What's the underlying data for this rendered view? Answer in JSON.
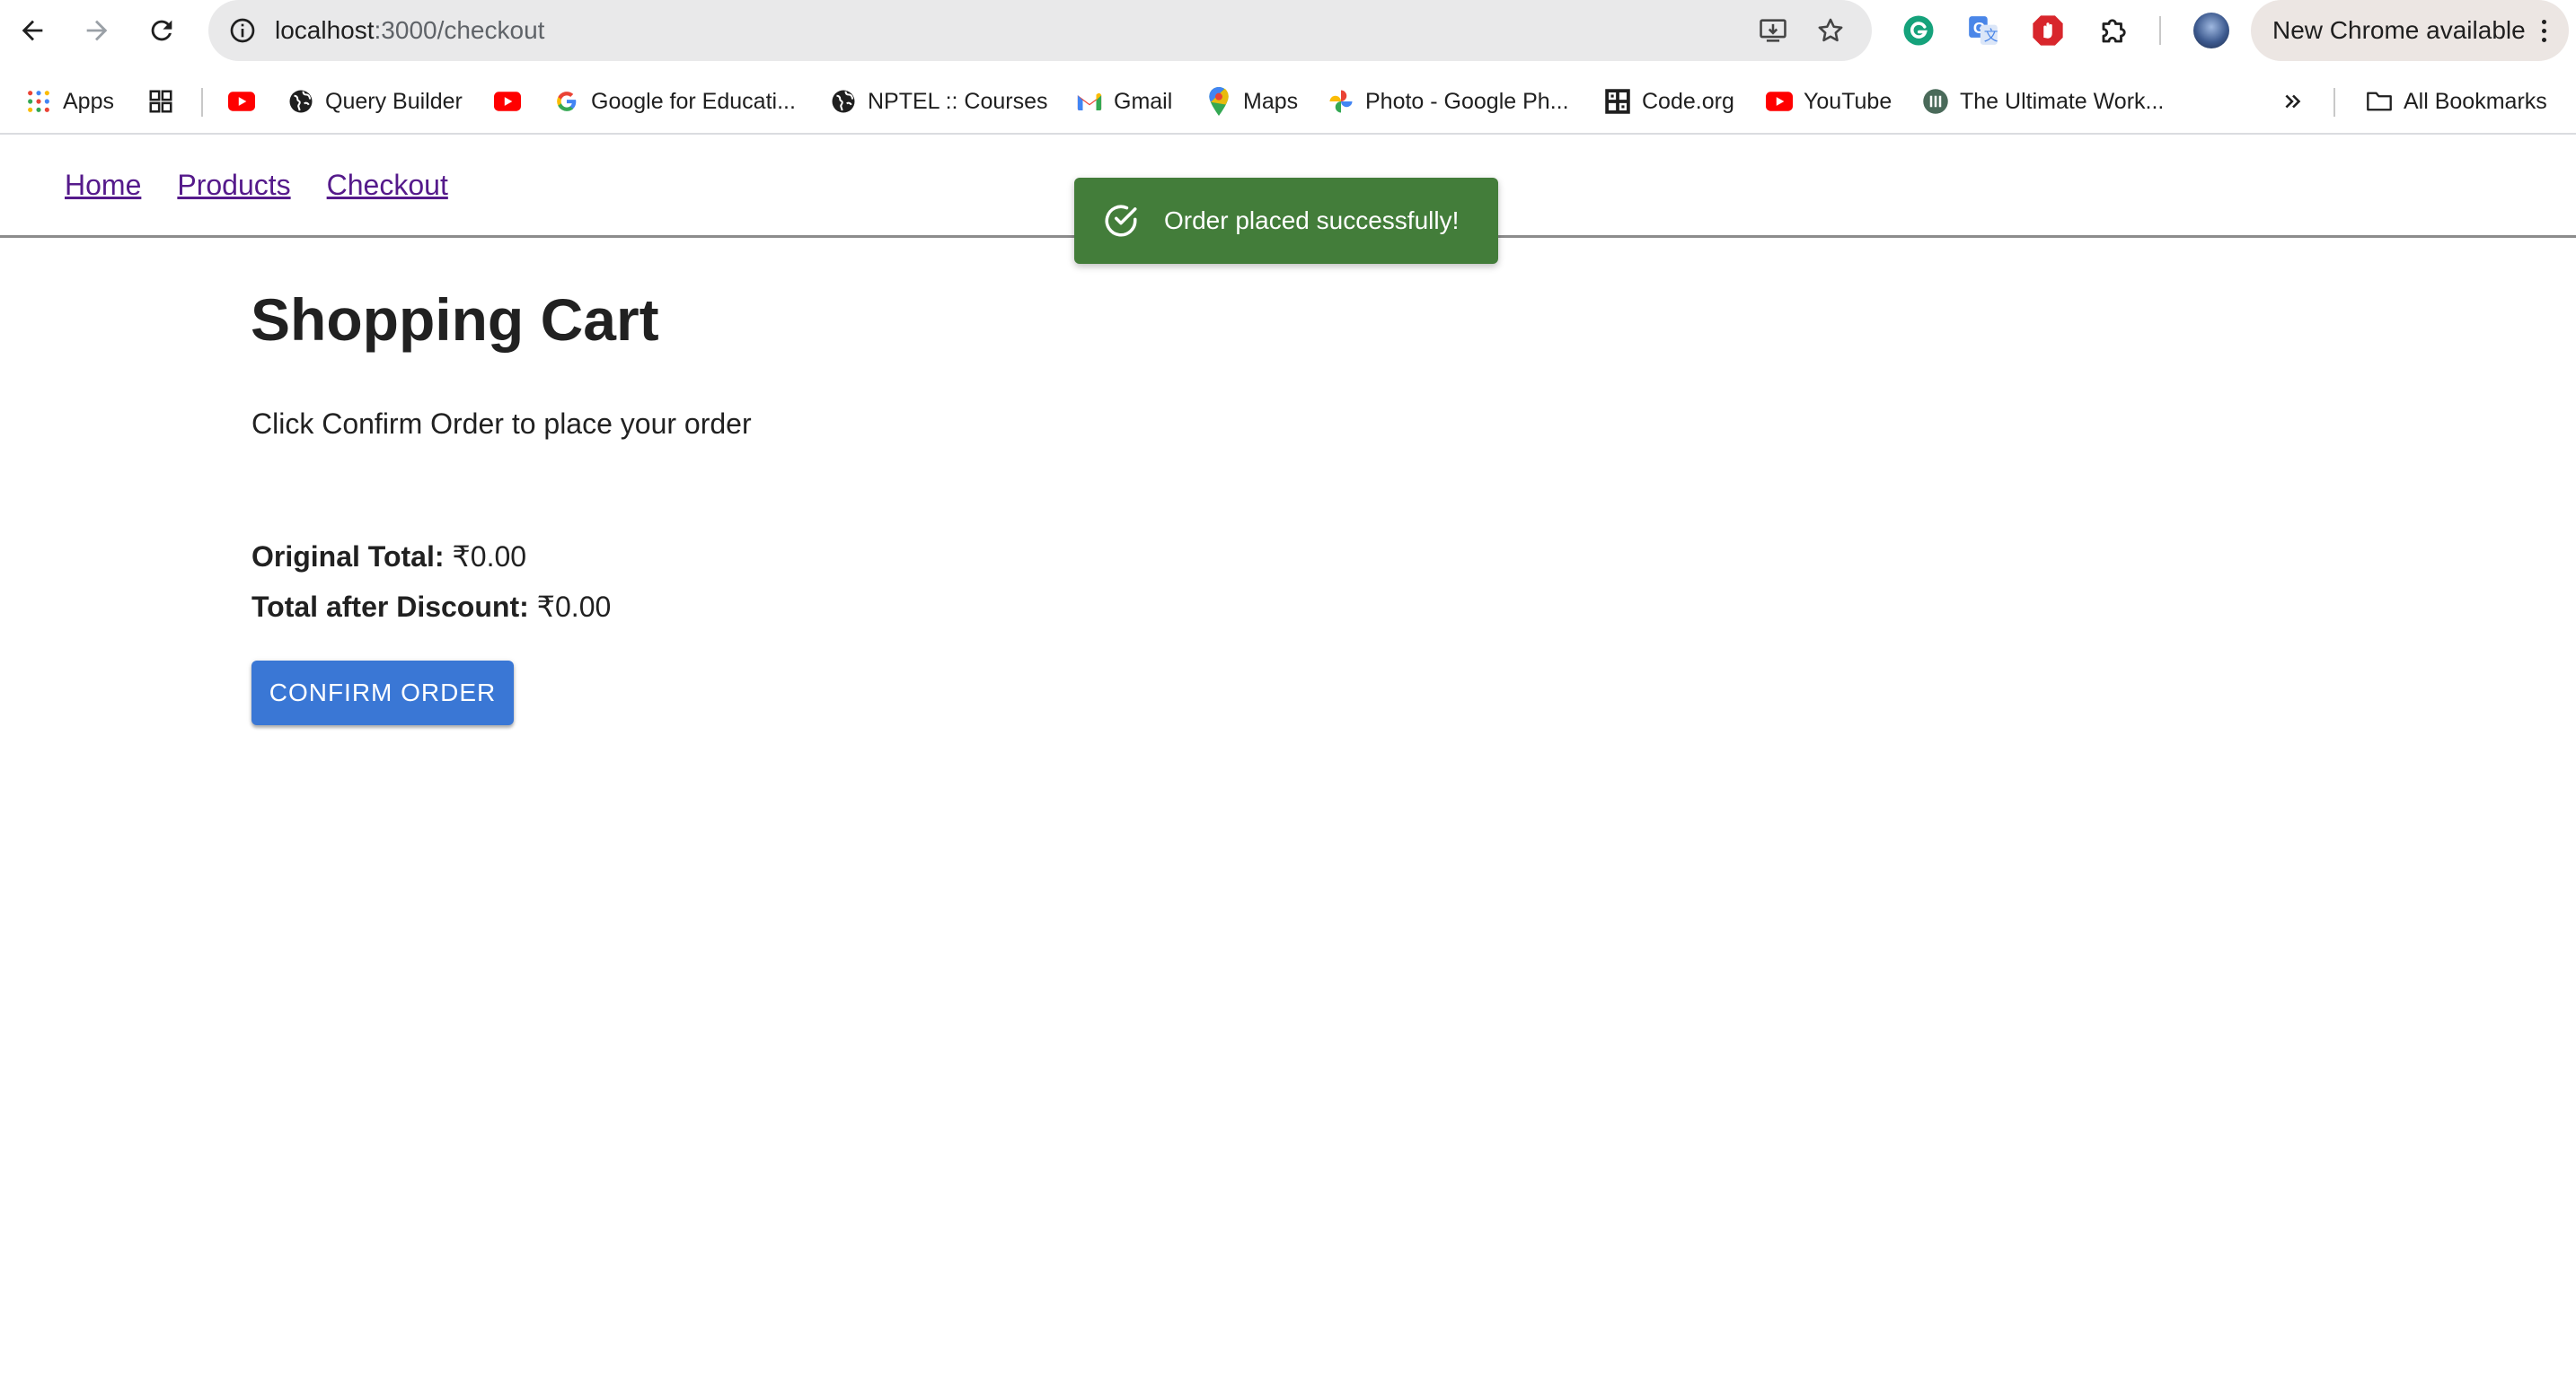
{
  "browser": {
    "url_host": "localhost",
    "url_path": ":3000/checkout",
    "update_label": "New Chrome available",
    "icons": [
      "back-arrow-icon",
      "forward-arrow-icon",
      "reload-icon",
      "site-info-icon",
      "install-app-icon",
      "bookmark-star-icon",
      "grammarly-icon",
      "google-translate-icon",
      "adblock-icon",
      "extensions-puzzle-icon",
      "profile-avatar",
      "kebab-menu-icon"
    ]
  },
  "bookmarks": {
    "apps": "Apps",
    "query_builder": "Query Builder",
    "google_edu": "Google for Educati...",
    "nptel": "NPTEL :: Courses",
    "gmail": "Gmail",
    "maps": "Maps",
    "photo": "Photo - Google Ph...",
    "codeorg": "Code.org",
    "youtube": "YouTube",
    "ultimate": "The Ultimate Work...",
    "all": "All Bookmarks"
  },
  "site_nav": {
    "home": "Home",
    "products": "Products",
    "checkout": "Checkout"
  },
  "cart": {
    "title": "Shopping Cart",
    "instructions": "Click Confirm Order to place your order",
    "original_total_label": "Original Total:",
    "original_total_value": " ₹0.00",
    "discount_total_label": "Total after Discount:",
    "discount_total_value": " ₹0.00",
    "confirm_label": "CONFIRM ORDER"
  },
  "toast": {
    "message": "Order placed successfully!"
  },
  "colors": {
    "primary_button": "#3a77d5",
    "toast_success": "#437d3a",
    "visited_link": "#551a8b"
  }
}
